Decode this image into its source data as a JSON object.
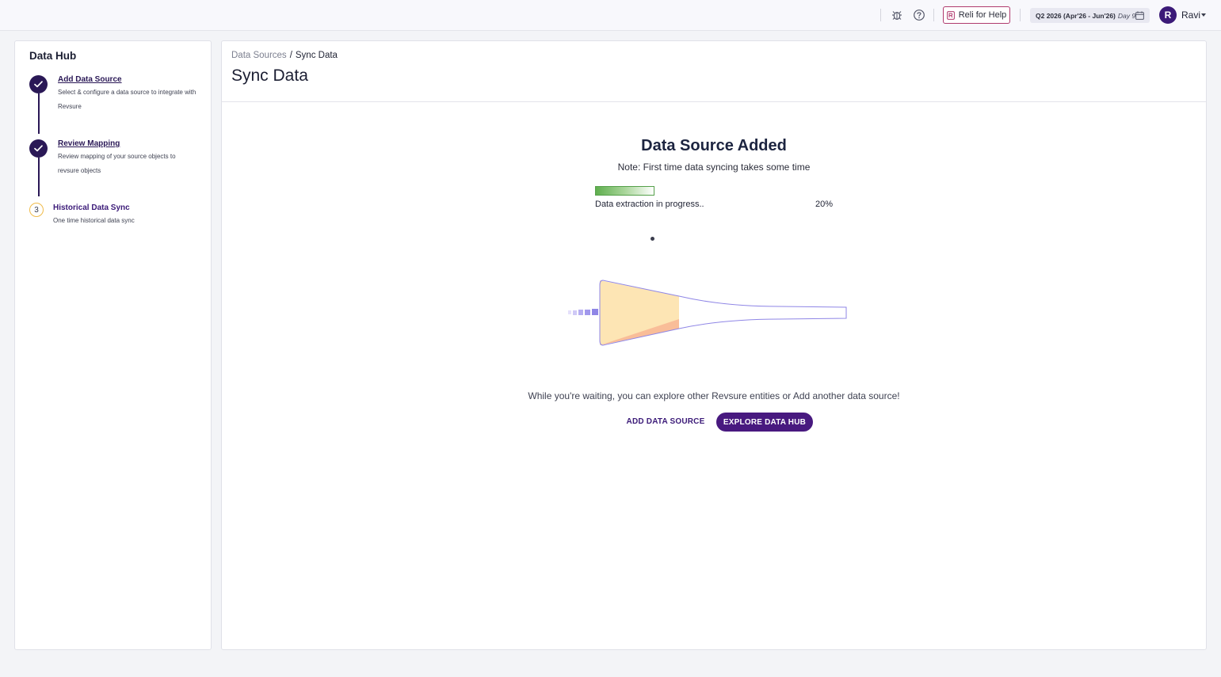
{
  "topbar": {
    "icons": [
      "bug-icon",
      "help-icon",
      "calendar-icon"
    ],
    "help_button_label": "Reli for Help",
    "quarter_label": "Q2 2026 (Apr'26 - Jun'26)",
    "day_label": "Day 9",
    "user_initial": "R",
    "user_name": "Ravi"
  },
  "sidebar": {
    "title": "Data Hub",
    "steps": [
      {
        "status": "done",
        "title": "Add Data Source",
        "desc_line1": "Select & configure a data source to integrate with",
        "desc_line2": "Revsure"
      },
      {
        "status": "done",
        "title": "Review Mapping",
        "desc_line1": "Review mapping of your source objects to",
        "desc_line2": "revsure objects"
      },
      {
        "status": "current",
        "number": "3",
        "title": "Historical Data Sync",
        "desc_line1": "One time historical data sync"
      }
    ]
  },
  "main": {
    "breadcrumb": {
      "parent": "Data Sources",
      "separator": "/",
      "current": "Sync Data"
    },
    "page_title": "Sync Data",
    "status_title": "Data Source Added",
    "note": "Note: First time data syncing takes some time",
    "progress": {
      "label": "Data extraction in progress..",
      "percent_text": "20%",
      "value": 0.2
    },
    "waiting_text": "While you're waiting, you can explore other Revsure entities or Add another data source!",
    "add_source_label": "ADD DATA SOURCE",
    "explore_label": "EXPLORE DATA HUB"
  },
  "colors": {
    "accent": "#48197f",
    "step_done": "#2a1856",
    "progress_green": "#5fae4e",
    "funnel_yellow": "#fde5b4",
    "funnel_orange": "#f9bd98",
    "funnel_outline": "#8f86e6"
  }
}
